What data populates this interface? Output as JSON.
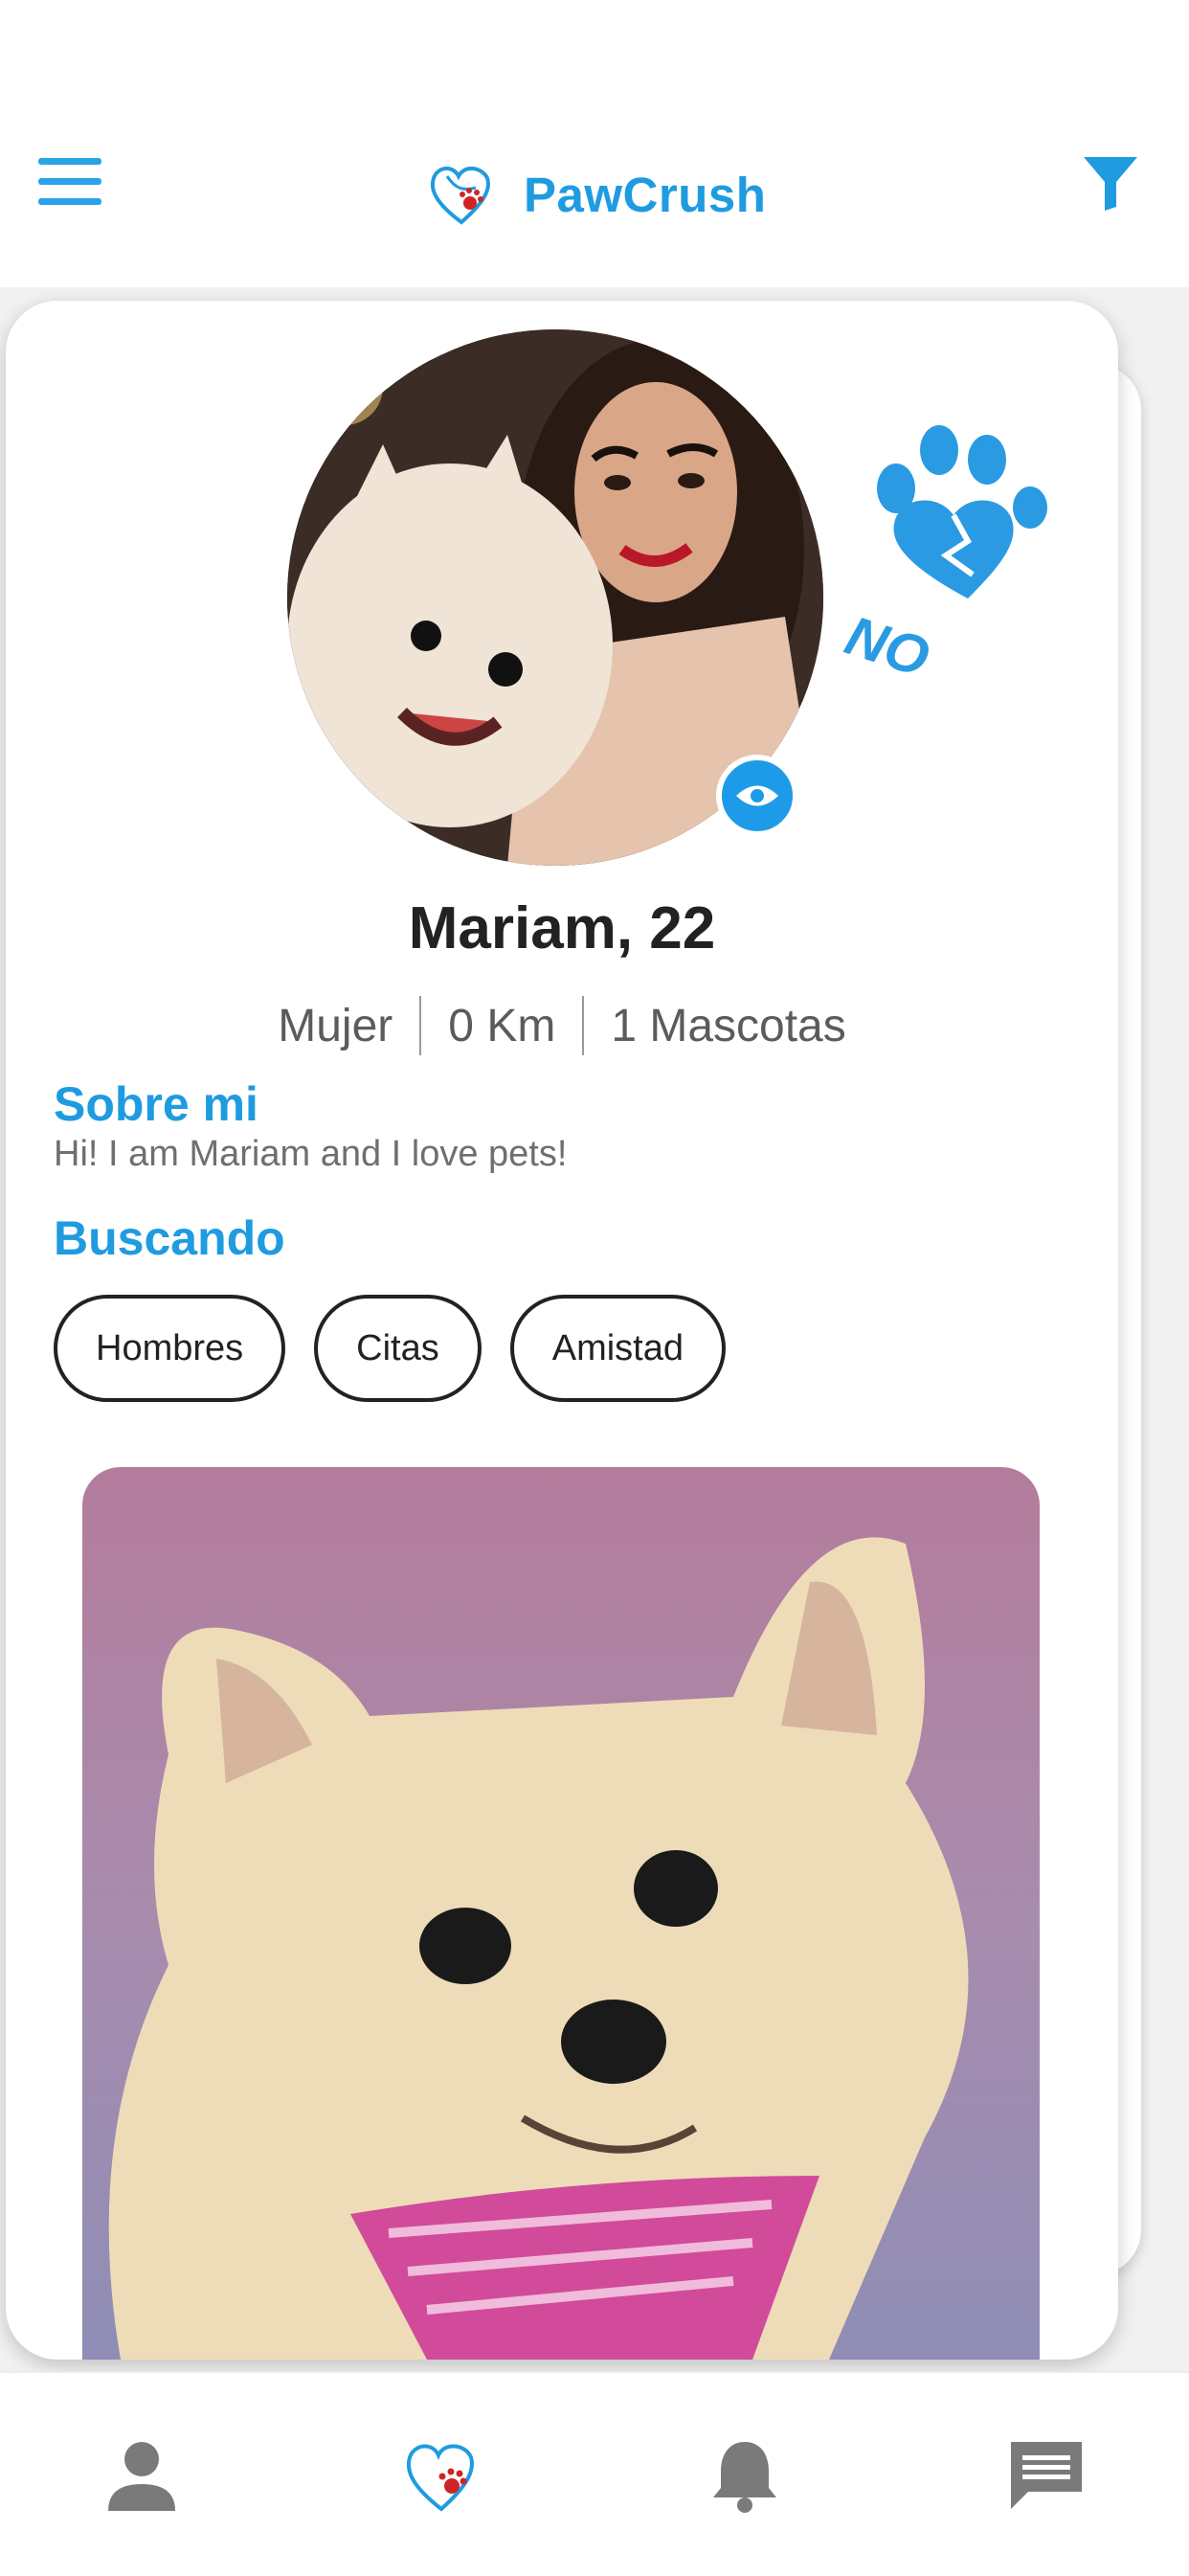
{
  "app": {
    "name": "PawCrush"
  },
  "header": {
    "menu_icon": "hamburger-menu-icon",
    "filter_icon": "filter-funnel-icon"
  },
  "swipe_badge": {
    "label": "NO",
    "icon": "broken-heart-paw-icon"
  },
  "profile": {
    "name_age": "Mariam, 22",
    "gender": "Mujer",
    "distance": "0 Km",
    "pets": "1 Mascotas",
    "about_title": "Sobre mi",
    "about_text": "Hi! I am Mariam and I love pets!",
    "looking_title": "Buscando",
    "looking_for": [
      "Hombres",
      "Citas",
      "Amistad"
    ]
  },
  "bottom_nav": {
    "items": [
      "profile-icon",
      "pawcrush-heart-icon",
      "notifications-bell-icon",
      "chat-message-icon"
    ]
  },
  "colors": {
    "accent": "#1f9be0",
    "text": "#222222",
    "muted": "#6f6f6f"
  }
}
